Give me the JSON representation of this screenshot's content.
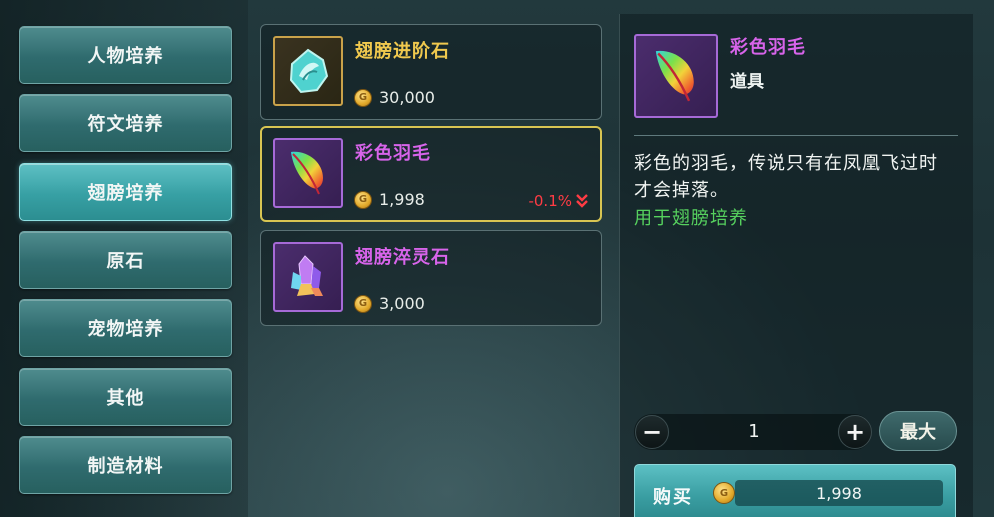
{
  "categories": [
    {
      "label": "人物培养",
      "active": false
    },
    {
      "label": "符文培养",
      "active": false
    },
    {
      "label": "翅膀培养",
      "active": true
    },
    {
      "label": "原石",
      "active": false
    },
    {
      "label": "宠物培养",
      "active": false
    },
    {
      "label": "其他",
      "active": false
    },
    {
      "label": "制造材料",
      "active": false
    }
  ],
  "items": [
    {
      "name": "翅膀进阶石",
      "price": "30,000",
      "icon": "wing-stone-icon",
      "rarity_color": "#f0c94e"
    },
    {
      "name": "彩色羽毛",
      "price": "1,998",
      "change": "-0.1%",
      "icon": "rainbow-feather-icon",
      "rarity_color": "#d764ea",
      "selected": true
    },
    {
      "name": "翅膀淬灵石",
      "price": "3,000",
      "icon": "crystal-cluster-icon",
      "rarity_color": "#d764ea"
    }
  ],
  "detail": {
    "name": "彩色羽毛",
    "type": "道具",
    "description": "彩色的羽毛，传说只有在凤凰飞过时才会掉落。",
    "usage": "用于翅膀培养",
    "icon": "rainbow-feather-icon"
  },
  "purchase": {
    "minus": "−",
    "plus": "+",
    "quantity": "1",
    "max_label": "最大",
    "buy_label": "购买",
    "total_price": "1,998"
  },
  "colors": {
    "accent": "#3a9ea2",
    "selected_border": "#d8c552",
    "price_drop": "#ff3c44",
    "usage_text": "#56d15e"
  }
}
